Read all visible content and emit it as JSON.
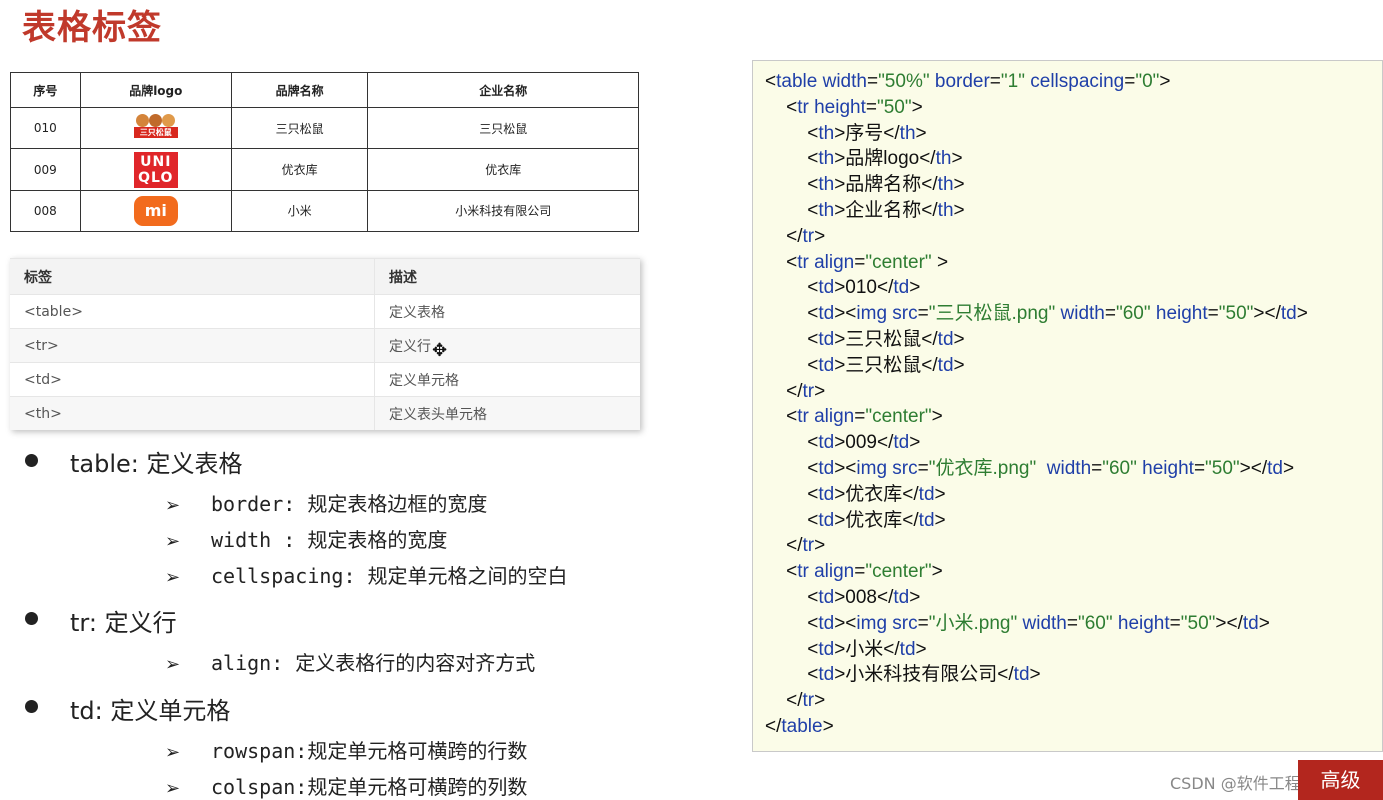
{
  "title": "表格标签",
  "demo_table": {
    "headers": [
      "序号",
      "品牌logo",
      "品牌名称",
      "企业名称"
    ],
    "rows": [
      {
        "id": "010",
        "logo_text": "三只松鼠",
        "brand": "三只松鼠",
        "company": "三只松鼠"
      },
      {
        "id": "009",
        "logo_text": "UNI QLO",
        "brand": "优衣库",
        "company": "优衣库"
      },
      {
        "id": "008",
        "logo_text": "mi",
        "brand": "小米",
        "company": "小米科技有限公司"
      }
    ]
  },
  "tag_table": {
    "headers": [
      "标签",
      "描述"
    ],
    "rows": [
      [
        "<table>",
        "定义表格"
      ],
      [
        "<tr>",
        "定义行"
      ],
      [
        "<td>",
        "定义单元格"
      ],
      [
        "<th>",
        "定义表头单元格"
      ]
    ]
  },
  "bullets": {
    "table": "table: 定义表格",
    "table_subs": [
      "border: 规定表格边框的宽度",
      "width : 规定表格的宽度",
      "cellspacing: 规定单元格之间的空白"
    ],
    "tr": "tr: 定义行",
    "tr_subs": [
      "align: 定义表格行的内容对齐方式"
    ],
    "td": "td: 定义单元格",
    "td_subs": [
      "rowspan:规定单元格可横跨的行数",
      "colspan:规定单元格可横跨的列数"
    ]
  },
  "watermark": "CSDN @软件工程师",
  "corner_text": "高级"
}
